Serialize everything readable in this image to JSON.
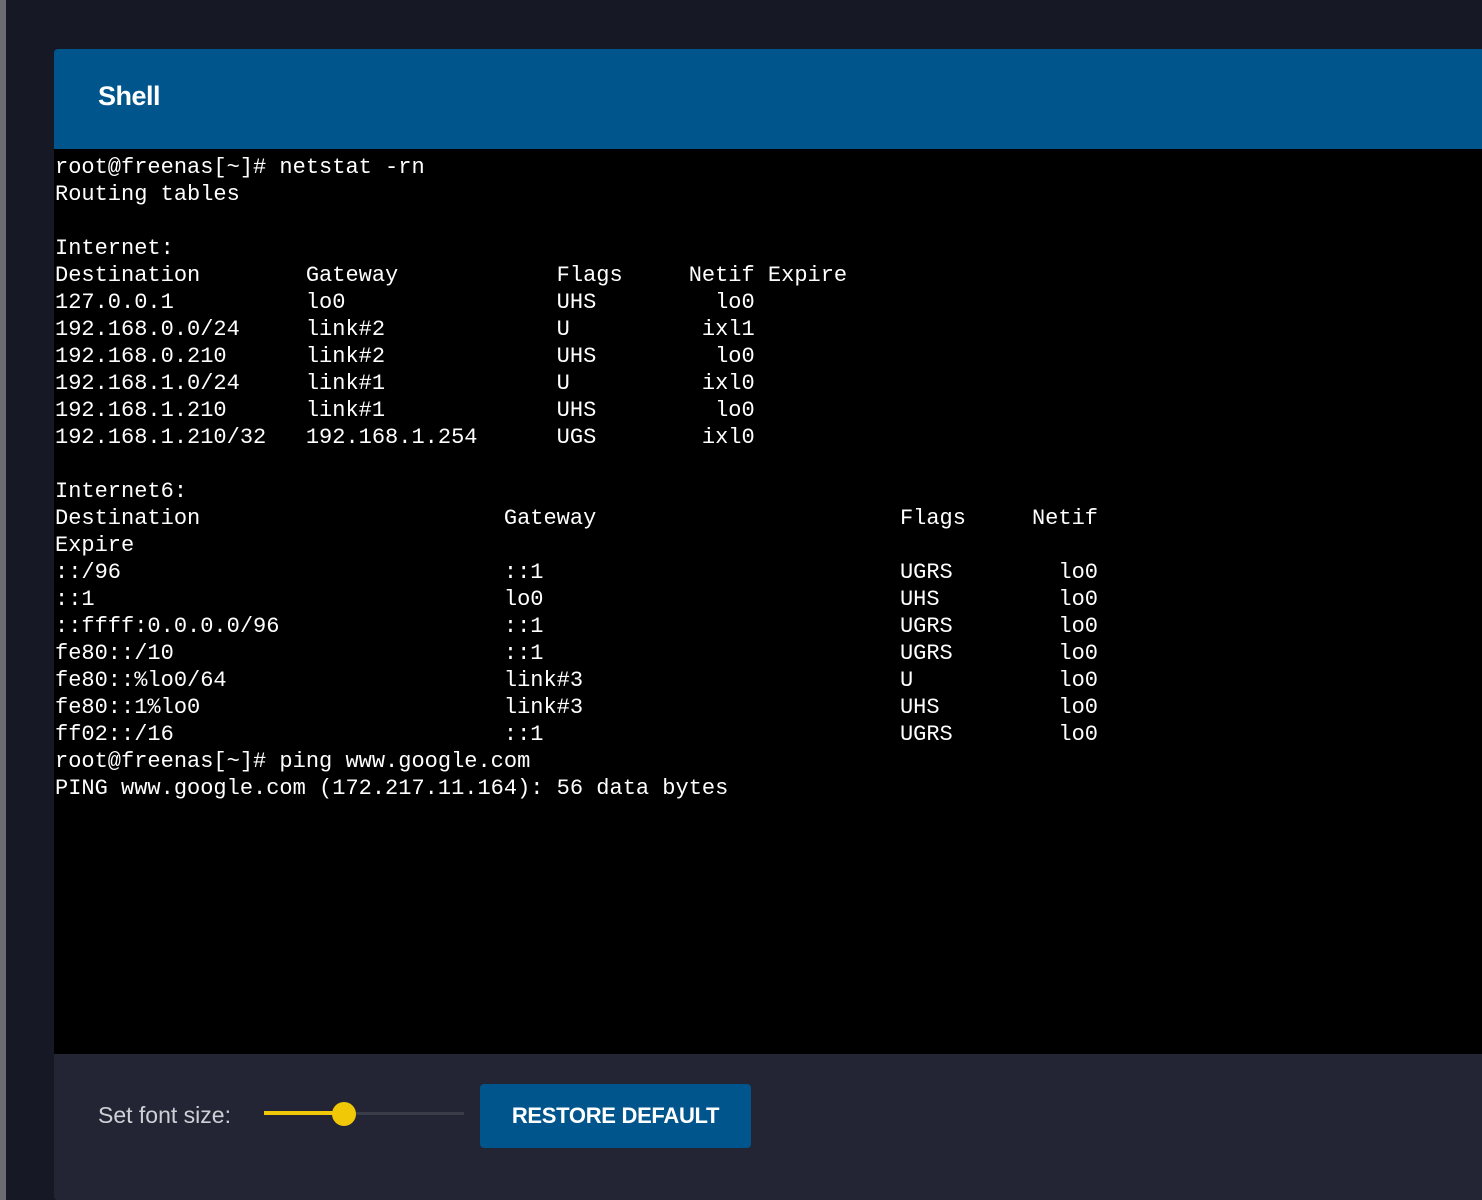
{
  "card": {
    "title": "Shell"
  },
  "terminal": {
    "lines": [
      "root@freenas[~]# netstat -rn",
      "Routing tables",
      "",
      "Internet:",
      "Destination        Gateway            Flags     Netif Expire",
      "127.0.0.1          lo0                UHS         lo0",
      "192.168.0.0/24     link#2             U          ixl1",
      "192.168.0.210      link#2             UHS         lo0",
      "192.168.1.0/24     link#1             U          ixl0",
      "192.168.1.210      link#1             UHS         lo0",
      "192.168.1.210/32   192.168.1.254      UGS        ixl0",
      "",
      "Internet6:",
      "Destination                       Gateway                       Flags     Netif",
      "Expire",
      "::/96                             ::1                           UGRS        lo0",
      "::1                               lo0                           UHS         lo0",
      "::ffff:0.0.0.0/96                 ::1                           UGRS        lo0",
      "fe80::/10                         ::1                           UGRS        lo0",
      "fe80::%lo0/64                     link#3                        U           lo0",
      "fe80::1%lo0                       link#3                        UHS         lo0",
      "ff02::/16                         ::1                           UGRS        lo0",
      "root@freenas[~]# ping www.google.com",
      "PING www.google.com (172.217.11.164): 56 data bytes"
    ]
  },
  "footer": {
    "font_size_label": "Set font size:",
    "font_size_level": 0.4,
    "restore_label": "RESTORE DEFAULT"
  },
  "colors": {
    "header": "#00558c",
    "accent": "#f0c808",
    "terminal_bg": "#000000"
  }
}
